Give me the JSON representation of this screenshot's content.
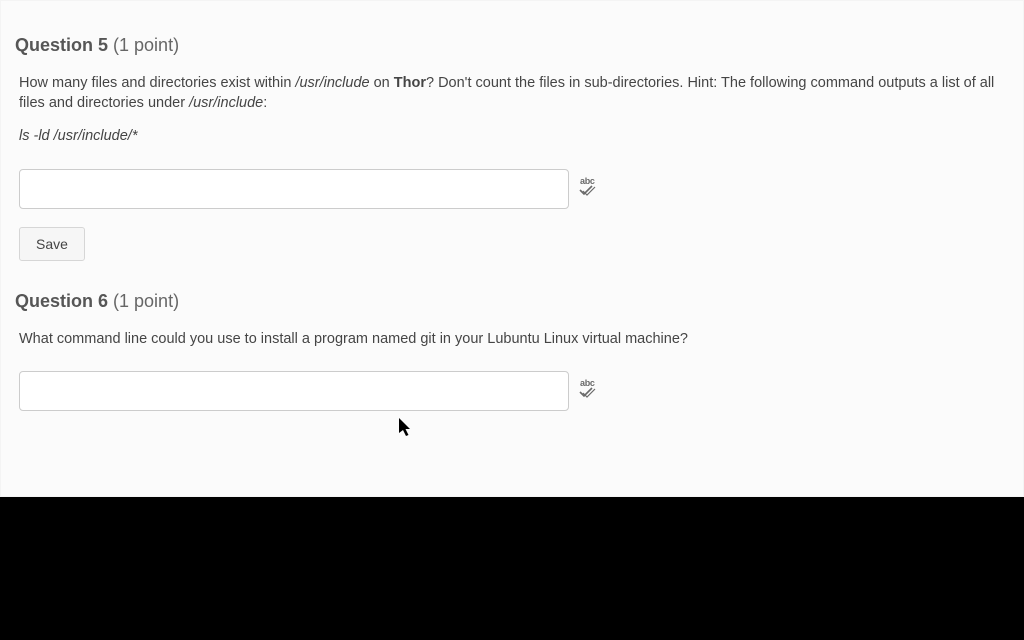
{
  "q5": {
    "label": "Question 5",
    "points": "(1 point)",
    "body_text_pre": "How many files and directories exist within ",
    "body_path1": "/usr/include",
    "body_text_mid": " on ",
    "body_bold": "Thor",
    "body_text_post": "? Don't count the files in sub-directories. Hint: The following command outputs a list of all files and directories under ",
    "body_path2": "/usr/include",
    "body_text_end": ":",
    "hint_command": "ls -ld /usr/include/*",
    "answer_value": "",
    "spellcheck_label": "abc",
    "save_label": "Save"
  },
  "q6": {
    "label": "Question 6",
    "points": "(1 point)",
    "body_text": "What command line could you use to install a program named git in your Lubuntu Linux virtual machine?",
    "answer_value": "",
    "spellcheck_label": "abc"
  }
}
